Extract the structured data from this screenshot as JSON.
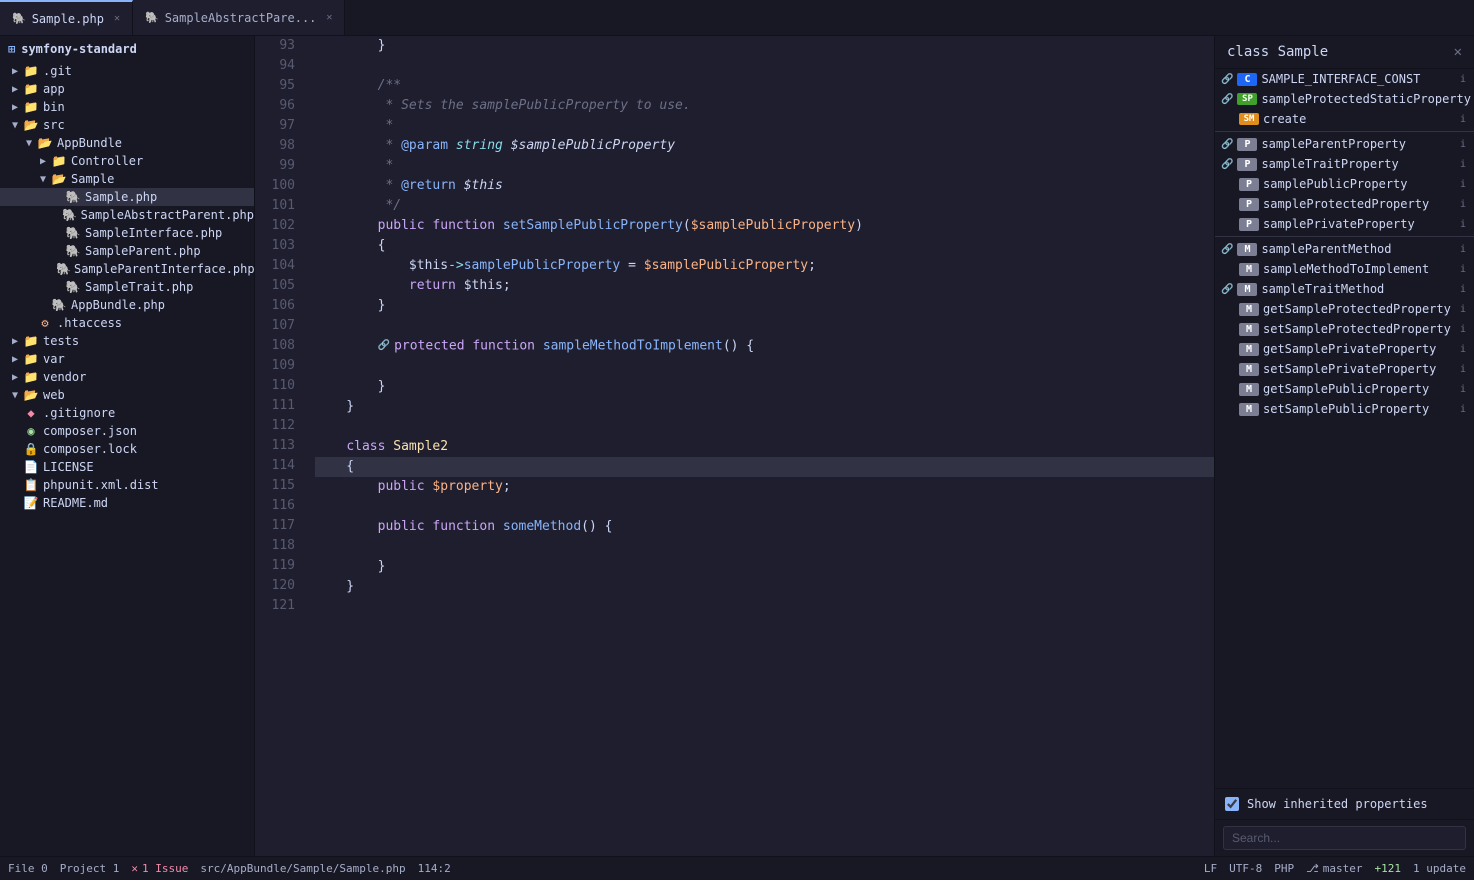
{
  "window": {
    "title": "symfony-standard"
  },
  "tabs": [
    {
      "id": "sample-php",
      "label": "Sample.php",
      "active": true,
      "icon": "🐘"
    },
    {
      "id": "sample-abstract",
      "label": "SampleAbstractPare...",
      "active": false,
      "icon": "🐘"
    }
  ],
  "sidebar": {
    "root": "symfony-standard",
    "items": [
      {
        "id": "git",
        "label": ".git",
        "type": "folder",
        "indent": 1,
        "collapsed": true
      },
      {
        "id": "app",
        "label": "app",
        "type": "folder",
        "indent": 1,
        "collapsed": true
      },
      {
        "id": "bin",
        "label": "bin",
        "type": "folder",
        "indent": 1,
        "collapsed": true
      },
      {
        "id": "src",
        "label": "src",
        "type": "folder",
        "indent": 1,
        "collapsed": false
      },
      {
        "id": "appbundle",
        "label": "AppBundle",
        "type": "folder",
        "indent": 2,
        "collapsed": false
      },
      {
        "id": "controller",
        "label": "Controller",
        "type": "folder",
        "indent": 3,
        "collapsed": true
      },
      {
        "id": "sample-folder",
        "label": "Sample",
        "type": "folder",
        "indent": 3,
        "collapsed": false
      },
      {
        "id": "sample-php-file",
        "label": "Sample.php",
        "type": "php",
        "indent": 4,
        "selected": true
      },
      {
        "id": "sample-abstract-php",
        "label": "SampleAbstractParent.php",
        "type": "php",
        "indent": 4
      },
      {
        "id": "sample-interface-php",
        "label": "SampleInterface.php",
        "type": "php",
        "indent": 4
      },
      {
        "id": "sample-parent-php",
        "label": "SampleParent.php",
        "type": "php",
        "indent": 4
      },
      {
        "id": "sample-parent-interface-php",
        "label": "SampleParentInterface.php",
        "type": "php",
        "indent": 4
      },
      {
        "id": "sample-trait-php",
        "label": "SampleTrait.php",
        "type": "php",
        "indent": 4
      },
      {
        "id": "appbundle-php",
        "label": "AppBundle.php",
        "type": "php",
        "indent": 3
      },
      {
        "id": "htaccess",
        "label": ".htaccess",
        "type": "config",
        "indent": 2
      },
      {
        "id": "tests",
        "label": "tests",
        "type": "folder",
        "indent": 1,
        "collapsed": true
      },
      {
        "id": "var",
        "label": "var",
        "type": "folder",
        "indent": 1,
        "collapsed": true
      },
      {
        "id": "vendor",
        "label": "vendor",
        "type": "folder",
        "indent": 1,
        "collapsed": true
      },
      {
        "id": "web",
        "label": "web",
        "type": "folder",
        "indent": 1,
        "collapsed": false
      },
      {
        "id": "gitignore",
        "label": ".gitignore",
        "type": "git",
        "indent": 1
      },
      {
        "id": "composer-json",
        "label": "composer.json",
        "type": "json",
        "indent": 1
      },
      {
        "id": "composer-lock",
        "label": "composer.lock",
        "type": "lock",
        "indent": 1
      },
      {
        "id": "license",
        "label": "LICENSE",
        "type": "license",
        "indent": 1
      },
      {
        "id": "phpunit-xml",
        "label": "phpunit.xml.dist",
        "type": "xml",
        "indent": 1
      },
      {
        "id": "readme",
        "label": "README.md",
        "type": "md",
        "indent": 1
      }
    ]
  },
  "editor": {
    "lines": [
      {
        "num": 93,
        "code": "        }"
      },
      {
        "num": 94,
        "code": ""
      },
      {
        "num": 95,
        "code": "        /**"
      },
      {
        "num": 96,
        "code": "         * Sets the samplePublicProperty to use."
      },
      {
        "num": 97,
        "code": "         *"
      },
      {
        "num": 98,
        "code": "         * @param string $samplePublicProperty"
      },
      {
        "num": 99,
        "code": "         *"
      },
      {
        "num": 100,
        "code": "         * @return $this"
      },
      {
        "num": 101,
        "code": "         */"
      },
      {
        "num": 102,
        "code": "        public function setSamplePublicProperty($samplePublicProperty)"
      },
      {
        "num": 103,
        "code": "        {"
      },
      {
        "num": 104,
        "code": "            $this->samplePublicProperty = $samplePublicProperty;"
      },
      {
        "num": 105,
        "code": "            return $this;"
      },
      {
        "num": 106,
        "code": "        }"
      },
      {
        "num": 107,
        "code": ""
      },
      {
        "num": 108,
        "code": "        protected function sampleMethodToImplement() {",
        "hasLink": true
      },
      {
        "num": 109,
        "code": ""
      },
      {
        "num": 110,
        "code": "        }"
      },
      {
        "num": 111,
        "code": "    }"
      },
      {
        "num": 112,
        "code": ""
      },
      {
        "num": 113,
        "code": "    class Sample2"
      },
      {
        "num": 114,
        "code": "    {",
        "highlighted": true
      },
      {
        "num": 115,
        "code": "        public $property;"
      },
      {
        "num": 116,
        "code": ""
      },
      {
        "num": 117,
        "code": "        public function someMethod() {"
      },
      {
        "num": 118,
        "code": ""
      },
      {
        "num": 119,
        "code": "        }"
      },
      {
        "num": 120,
        "code": "    }"
      },
      {
        "num": 121,
        "code": ""
      }
    ]
  },
  "right_panel": {
    "title": "class Sample",
    "items": [
      {
        "badge": "C",
        "badge_type": "c",
        "name": "SAMPLE_INTERFACE_CONST",
        "has_link": true
      },
      {
        "badge": "SP",
        "badge_type": "sp",
        "name": "sampleProtectedStaticProperty",
        "has_link": true
      },
      {
        "badge": "SM",
        "badge_type": "sm",
        "name": "create"
      },
      {
        "divider": true
      },
      {
        "badge": "P",
        "badge_type": "p",
        "name": "sampleParentProperty",
        "has_link": true
      },
      {
        "badge": "P",
        "badge_type": "p",
        "name": "sampleTraitProperty",
        "has_link": true
      },
      {
        "badge": "P",
        "badge_type": "p",
        "name": "samplePublicProperty"
      },
      {
        "badge": "P",
        "badge_type": "p",
        "name": "sampleProtectedProperty"
      },
      {
        "badge": "P",
        "badge_type": "p",
        "name": "samplePrivateProperty"
      },
      {
        "divider": true
      },
      {
        "badge": "M",
        "badge_type": "m",
        "name": "sampleParentMethod",
        "has_link": true
      },
      {
        "badge": "M",
        "badge_type": "m",
        "name": "sampleMethodToImplement"
      },
      {
        "badge": "M",
        "badge_type": "m",
        "name": "sampleTraitMethod",
        "has_link": true
      },
      {
        "badge": "M",
        "badge_type": "m",
        "name": "getSampleProtectedProperty"
      },
      {
        "badge": "M",
        "badge_type": "m",
        "name": "setSampleProtectedProperty"
      },
      {
        "badge": "M",
        "badge_type": "m",
        "name": "getSamplePrivateProperty"
      },
      {
        "badge": "M",
        "badge_type": "m",
        "name": "setSamplePrivateProperty"
      },
      {
        "badge": "M",
        "badge_type": "m",
        "name": "getSamplePublicProperty"
      },
      {
        "badge": "M",
        "badge_type": "m",
        "name": "setSamplePublicProperty"
      }
    ],
    "show_inherited": true,
    "show_inherited_label": "Show inherited properties",
    "search_placeholder": "Search..."
  },
  "status_bar": {
    "file_count": "File 0",
    "project_count": "Project 1",
    "issues": "1 Issue",
    "file_path": "src/AppBundle/Sample/Sample.php",
    "cursor": "114:2",
    "line_ending": "LF",
    "encoding": "UTF-8",
    "language": "PHP",
    "vcs": "master",
    "changes": "+121",
    "updates": "1 update"
  }
}
